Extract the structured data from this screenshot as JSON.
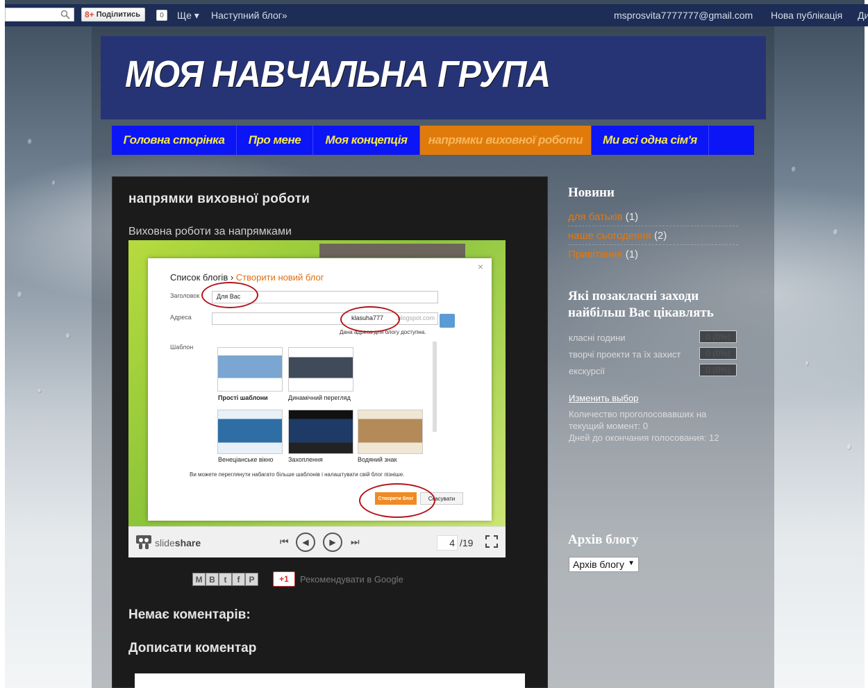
{
  "navbar": {
    "share_label": "Поділитись",
    "share_count": "0",
    "more_label": "Ще ▾",
    "next_blog_label": "Наступний блог»",
    "account_email": "msprosvita7777777@gmail.com",
    "new_post_label": "Нова публікація",
    "tail_label": "Ди"
  },
  "header": {
    "blog_title": "МОЯ НАВЧАЛЬНА ГРУПА"
  },
  "tabs": [
    {
      "label": "Головна сторінка",
      "active": false
    },
    {
      "label": "Про мене",
      "active": false
    },
    {
      "label": "Моя концепція",
      "active": false
    },
    {
      "label": "напрямки виховної роботи",
      "active": true
    },
    {
      "label": "Ми всі одна сім'я",
      "active": false
    }
  ],
  "post": {
    "title": "напрямки виховної роботи",
    "body_text": "Виховна роботи за напрямками",
    "slide": {
      "crumb_left": "Список блогів",
      "crumb_sep": " › ",
      "crumb_right": "Створити новий блог",
      "title_label": "Заголовок",
      "title_value": "Для Вас",
      "address_label": "Адреса",
      "address_value": "klasuha777",
      "address_suffix": ".blogspot.com",
      "address_hint": "Дана адреса для блогу доступна.",
      "template_label": "Шаблон",
      "templates": [
        "Прості шаблони",
        "Динамічний перегляд",
        "Венеціанське вікно",
        "Захоплення",
        "Водяний знак"
      ],
      "footer_text": "Ви можете переглянути набагато більше шаблонів і налаштувати свій блог пізніше.",
      "create_label": "Створити блог",
      "cancel_label": "Скасувати",
      "close_glyph": "×"
    },
    "player": {
      "brand_light": "slide",
      "brand_bold": "share",
      "current_page": "4",
      "total_pages": "/19"
    },
    "share": {
      "buttons": [
        "M",
        "B",
        "t",
        "f",
        "P"
      ],
      "gplus_label": "+1",
      "recommend_text": "Рекомендувати в Google"
    },
    "no_comments": "Немає коментарів:",
    "add_comment": "Дописати коментар"
  },
  "sidebar": {
    "labels_heading": "Новини",
    "labels": [
      {
        "name": "для батьків",
        "count": "(1)"
      },
      {
        "name": "наше сьогодення",
        "count": "(2)"
      },
      {
        "name": "Привітання",
        "count": "(1)"
      }
    ],
    "poll_heading_line1": "Які позакласні заходи",
    "poll_heading_line2": "найбільш Вас цікавлять",
    "poll_options": [
      {
        "label": "класні години",
        "value": "0 (0%)"
      },
      {
        "label": "творчі проекти та їх захист",
        "value": "0 (0%)"
      },
      {
        "label": "екскурсії",
        "value": "0 (0%)"
      }
    ],
    "poll_change_link": "Изменить выбор",
    "poll_stat_line1": "Количество проголосовавших на",
    "poll_stat_line2": "текущий момент: 0",
    "poll_stat_line3": "Дней до окончания голосования: 12",
    "archive_heading": "Архів блогу",
    "archive_select": "Архів блогу"
  },
  "colors": {
    "navbar_bg": "#1d2d55",
    "header_bg": "#263475",
    "tab_bar": "#0c15f5",
    "tab_text": "#f4e94a",
    "tab_active": "#e07b0b",
    "post_bg": "#1b1b1b",
    "link_orange": "#e2780f"
  }
}
